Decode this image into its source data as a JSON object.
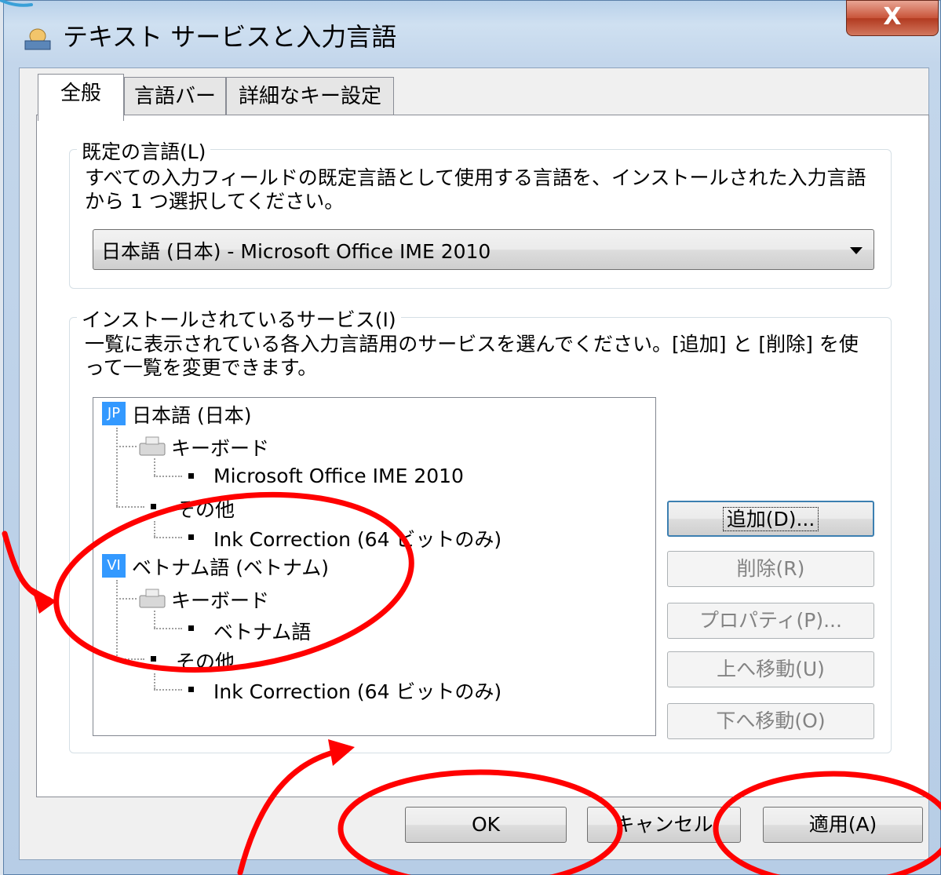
{
  "window": {
    "title": "テキスト サービスと入力言語",
    "close_label": "X"
  },
  "tabs": [
    {
      "label": "全般",
      "active": true
    },
    {
      "label": "言語バー",
      "active": false
    },
    {
      "label": "詳細なキー設定",
      "active": false
    }
  ],
  "default_language": {
    "group_label": "既定の言語(L)",
    "description_line1": "すべての入力フィールドの既定言語として使用する言語を、インストールされた入力言語",
    "description_line2": "から 1 つ選択してください。",
    "selected_value": "日本語 (日本) - Microsoft Office IME 2010"
  },
  "installed_services": {
    "group_label": "インストールされているサービス(I)",
    "description_line1": "一覧に表示されている各入力言語用のサービスを選んでください。[追加] と [削除] を使",
    "description_line2": "って一覧を変更できます。",
    "tree": [
      {
        "badge": "JP",
        "label": "日本語 (日本)",
        "keyboard_label": "キーボード",
        "keyboard_item": "Microsoft Office IME 2010",
        "other_label": "その他",
        "other_item": "Ink Correction (64 ビットのみ)"
      },
      {
        "badge": "VI",
        "label": "ベトナム語 (ベトナム)",
        "keyboard_label": "キーボード",
        "keyboard_item": "ベトナム語",
        "other_label": "その他",
        "other_item": "Ink Correction (64 ビットのみ)"
      }
    ],
    "buttons": {
      "add": "追加(D)...",
      "remove": "削除(R)",
      "properties": "プロパティ(P)...",
      "move_up": "上へ移動(U)",
      "move_down": "下へ移動(O)"
    }
  },
  "footer": {
    "ok": "OK",
    "cancel": "キャンセル",
    "apply": "適用(A)"
  },
  "colors": {
    "annotation": "#ff0000",
    "selection_badge": "#3399ff"
  }
}
